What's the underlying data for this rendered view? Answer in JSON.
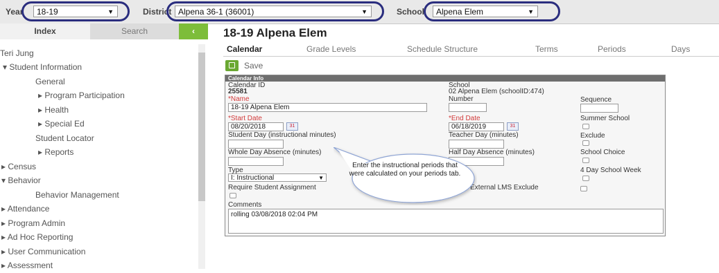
{
  "topbar": {
    "year_label": "Year",
    "year_value": "18-19",
    "district_label": "District",
    "district_value": "Alpena 36-1 (36001)",
    "school_label": "School",
    "school_value": "Alpena Elem"
  },
  "left_tabs": {
    "index": "Index",
    "search": "Search",
    "collapse": "‹"
  },
  "tree": {
    "user": "Teri Jung",
    "items": [
      "▾ Student Information",
      "General",
      "▸ Program Participation",
      "▸ Health",
      "▸ Special Ed",
      "Student Locator",
      "▸ Reports",
      "▸ Census",
      "▾ Behavior",
      "Behavior Management",
      "▸ Attendance",
      "▸ Program Admin",
      "▸ Ad Hoc Reporting",
      "▸ User Communication",
      "▸ Assessment"
    ]
  },
  "main": {
    "title": "18-19 Alpena Elem",
    "tabs": [
      "Calendar",
      "Grade Levels",
      "Schedule Structure",
      "Terms",
      "Periods",
      "Days"
    ],
    "save_label": "Save"
  },
  "panel": {
    "header": "Calendar Info",
    "calendar_id_label": "Calendar ID",
    "calendar_id_value": "25581",
    "school_label": "School",
    "school_value": "02 Alpena Elem (schoolID:474)",
    "name_label": "*Name",
    "name_value": "18-19 Alpena Elem",
    "number_label": "Number",
    "sequence_label": "Sequence",
    "start_date_label": "*Start Date",
    "start_date_value": "08/20/2018",
    "end_date_label": "*End Date",
    "end_date_value": "06/18/2019",
    "summer_school_label": "Summer School",
    "student_day_label": "Student Day (instructional minutes)",
    "teacher_day_label": "Teacher Day (minutes)",
    "exclude_label": "Exclude",
    "whole_day_label": "Whole Day Absence (minutes)",
    "half_day_label": "Half Day Absence (minutes)",
    "school_choice_label": "School Choice",
    "type_label": "Type",
    "type_value": "I: Instructional",
    "four_day_label": "4 Day School Week",
    "require_label": "Require Student Assignment",
    "lms_label": "Ignore External LMS Exclude",
    "comments_label": "Comments",
    "comments_value": "rolling 03/08/2018 02:04 PM"
  },
  "callout": {
    "text": "Enter the instructional periods that were calculated on your periods tab."
  },
  "colors": {
    "highlight_oval": "#2a2d7e",
    "accent_green": "#7dbd3a",
    "required_red": "#d23a3a"
  }
}
